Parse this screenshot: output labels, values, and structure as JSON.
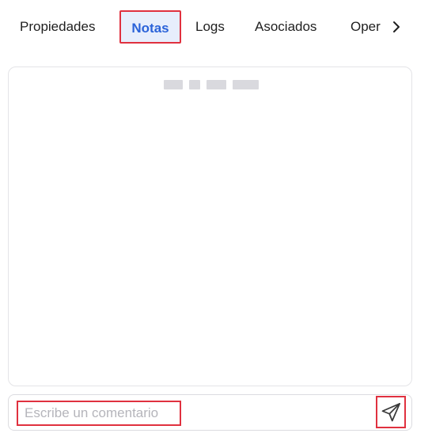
{
  "tabs": {
    "items": [
      {
        "label": "Propiedades"
      },
      {
        "label": "Notas"
      },
      {
        "label": "Logs"
      },
      {
        "label": "Asociados"
      },
      {
        "label": "Oper"
      }
    ],
    "active_index": 1,
    "scroll_right_icon": "chevron-right-icon"
  },
  "notes": {
    "header_redacted": true
  },
  "composer": {
    "placeholder": "Escribe un comentario",
    "value": "",
    "send_icon": "send-icon"
  },
  "colors": {
    "active_tab_text": "#2b63d9",
    "active_tab_bg": "#e7eefc",
    "highlight_border": "#e0313f",
    "panel_border": "#e4e4e7",
    "placeholder": "#b5b5bb"
  }
}
